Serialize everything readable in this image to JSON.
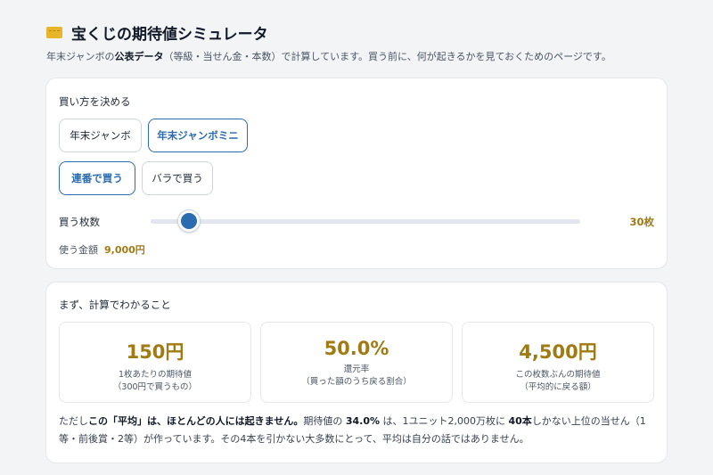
{
  "header": {
    "icon": "ticket-icon",
    "title": "宝くじの期待値シミュレータ",
    "subtitle_pre": "年末ジャンボの",
    "subtitle_bold": "公表データ",
    "subtitle_post": "（等級・当せん金・本数）で計算しています。買う前に、何が起きるかを見ておくためのページです。"
  },
  "purchase": {
    "heading": "買い方を決める",
    "lottery_options": [
      {
        "label": "年末ジャンボ",
        "selected": false
      },
      {
        "label": "年末ジャンボミニ",
        "selected": true
      }
    ],
    "method_options": [
      {
        "label": "連番で買う",
        "selected": true
      },
      {
        "label": "バラで買う",
        "selected": false
      }
    ],
    "quantity_label": "買う枚数",
    "quantity_value": "30枚",
    "quantity_fraction": 0.09,
    "amount_label": "使う金額",
    "amount_value": "9,000円"
  },
  "results": {
    "heading": "まず、計算でわかること",
    "stats": [
      {
        "value": "150円",
        "caption1": "1枚あたりの期待値",
        "caption2": "（300円で買うもの）"
      },
      {
        "value": "50.0%",
        "caption1": "還元率",
        "caption2": "（買った額のうち戻る割合）"
      },
      {
        "value": "4,500円",
        "caption1": "この枚数ぶんの期待値",
        "caption2": "（平均的に戻る額）"
      }
    ],
    "note": {
      "t1": "ただし",
      "b1": "この「平均」は、ほとんどの人には起きません。",
      "t2": "期待値の ",
      "b2": "34.0%",
      "t3": " は、1ユニット2,000万枚に ",
      "b3": "40本",
      "t4": "しかない上位の当せん（1等・前後賞・2等）が作っています。その4本を引かない大多数にとって、平均は自分の話ではありません。"
    }
  },
  "colors": {
    "accent": "#2b6cb0",
    "gold": "#a07a12",
    "background": "#f3f4f6"
  }
}
